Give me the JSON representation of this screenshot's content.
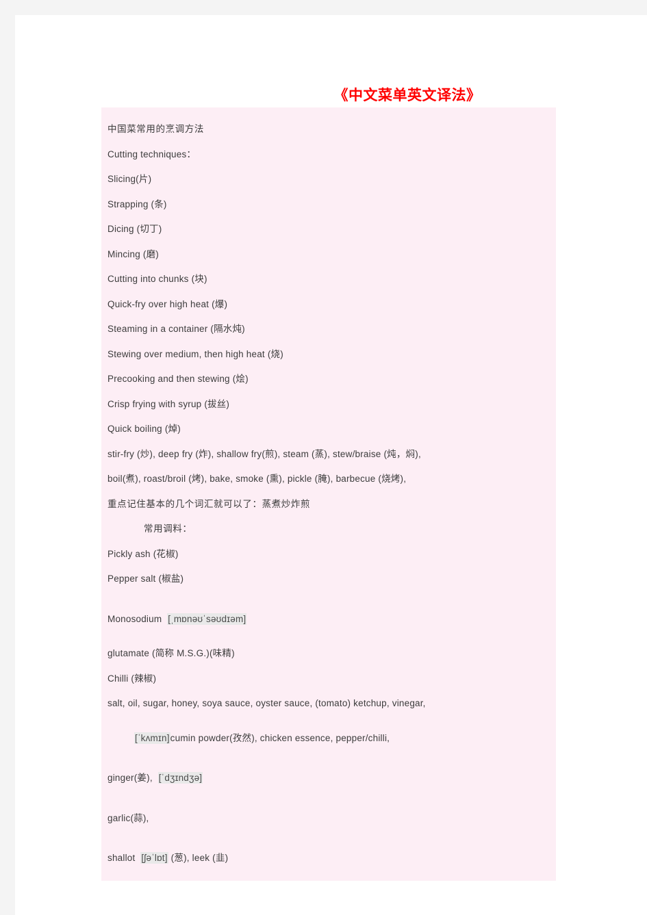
{
  "document": {
    "title": "《中文菜单英文译法》",
    "title_color": "#ff0000",
    "block_background": "#fdeef5",
    "text_color": "#3c3c3c",
    "ipa_highlight_color": "#e9e9e9"
  },
  "content": {
    "section_cooking_heading": "中国菜常用的烹调方法",
    "cutting_heading": "Cutting techniques：",
    "lines": [
      "Slicing(片)",
      "Strapping (条)",
      "Dicing (切丁)",
      "Mincing (磨)",
      "Cutting into chunks (块)",
      "Quick-fry over high heat (爆)",
      "Steaming in a container (隔水炖)",
      "Stewing over medium, then high heat (烧)",
      "Precooking and then stewing (烩)",
      "Crisp frying with syrup (拔丝)",
      "Quick boiling (焯)"
    ],
    "methods_line_1": "stir-fry (炒), deep fry (炸),   shallow fry(煎), steam (蒸), stew/braise (炖，焖),",
    "methods_line_2": "boil(煮), roast/broil (烤), bake, smoke (熏), pickle (腌), barbecue (烧烤),",
    "summary_line": "重点记住基本的几个词汇就可以了：蒸煮炒炸煎",
    "seasonings_heading": "常用调料：",
    "seasoning_lines": [
      "Pickly ash (花椒)",
      "Pepper salt (椒盐)"
    ],
    "monosodium_word": "Monosodium",
    "monosodium_ipa": "[ˌmɒnəʊˈsəʊdɪəm]",
    "glutamate_line": "glutamate (简称 M.S.G.)(味精)",
    "chilli_line": "Chilli (辣椒)",
    "condiments_line": "salt, oil, sugar, honey, soya sauce, oyster sauce, (tomato) ketchup, vinegar,",
    "cumin_ipa": "[ˈkʌmɪn]",
    "cumin_rest": "cumin powder(孜然), chicken essence, pepper/chilli,",
    "ginger_word": "ginger(姜),",
    "ginger_ipa": "[ˈdʒɪndʒə]",
    "garlic_line": "garlic(蒜),",
    "shallot_word": "shallot",
    "shallot_ipa": "[ʃəˈlɒt]",
    "shallot_rest": "(葱), leek (韭)"
  }
}
